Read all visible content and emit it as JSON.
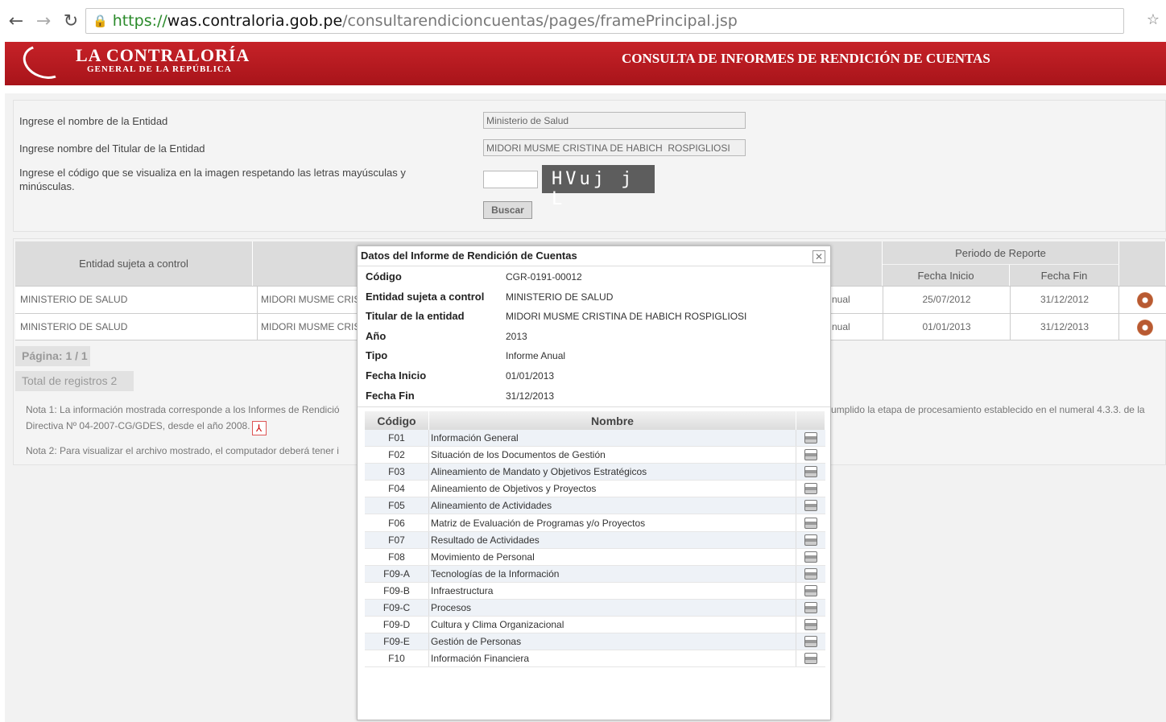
{
  "browser": {
    "url_scheme": "https://",
    "url_host": "was.contraloria.gob.pe",
    "url_path": "/consultarendicioncuentas/pages/framePrincipal.jsp"
  },
  "header": {
    "logo_title": "LA CONTRALORÍA",
    "logo_subtitle": "GENERAL DE LA REPÚBLICA",
    "page_title": "CONSULTA DE INFORMES DE RENDICIÓN DE CUENTAS"
  },
  "form": {
    "entidad_label": "Ingrese el nombre de la Entidad",
    "entidad_value": "Ministerio de Salud",
    "titular_label": "Ingrese nombre del Titular de la Entidad",
    "titular_value": "MIDORI MUSME CRISTINA DE HABICH  ROSPIGLIOSI",
    "captcha_label_1": "Ingrese el código que se visualiza en la imagen respetando las letras mayúsculas y",
    "captcha_label_2": "minúsculas.",
    "captcha_text": "HVuj j L",
    "buscar_label": "Buscar"
  },
  "results": {
    "col_entidad": "Entidad sujeta a control",
    "col_periodo": "Periodo de Reporte",
    "col_fecha_inicio": "Fecha Inicio",
    "col_fecha_fin": "Fecha Fin",
    "rows": [
      {
        "entidad": "MINISTERIO DE SALUD",
        "titular": "MIDORI MUSME CRIST",
        "tipo": "nual",
        "fecha_inicio": "25/07/2012",
        "fecha_fin": "31/12/2012"
      },
      {
        "entidad": "MINISTERIO DE SALUD",
        "titular": "MIDORI MUSME CRIST",
        "tipo": "nual",
        "fecha_inicio": "01/01/2013",
        "fecha_fin": "31/12/2013"
      }
    ],
    "pagina": "Página: 1 / 1",
    "total": "Total de registros 2",
    "nota1_left": "Nota 1: La información mostrada corresponde a los Informes de Rendició",
    "nota1_right": "umplido la etapa de procesamiento establecido en el numeral 4.3.3. de la",
    "nota1_line2": "Directiva Nº 04-2007-CG/GDES, desde el año 2008.",
    "nota2": "Nota 2: Para visualizar el archivo mostrado, el computador deberá tener i"
  },
  "modal": {
    "title": "Datos del Informe de Rendición de Cuentas",
    "codigo_label": "Código",
    "codigo_value": "CGR-0191-00012",
    "entidad_label": "Entidad sujeta a control",
    "entidad_value": "MINISTERIO DE SALUD",
    "titular_label": "Titular de la entidad",
    "titular_value": "MIDORI MUSME CRISTINA DE HABICH ROSPIGLIOSI",
    "anio_label": "Año",
    "anio_value": "2013",
    "tipo_label": "Tipo",
    "tipo_value": "Informe Anual",
    "fecha_inicio_label": "Fecha Inicio",
    "fecha_inicio_value": "01/01/2013",
    "fecha_fin_label": "Fecha Fin",
    "fecha_fin_value": "31/12/2013",
    "col_codigo": "Código",
    "col_nombre": "Nombre",
    "formatos": [
      {
        "codigo": "F01",
        "nombre": "Información General"
      },
      {
        "codigo": "F02",
        "nombre": "Situación de los Documentos de Gestión"
      },
      {
        "codigo": "F03",
        "nombre": "Alineamiento de Mandato y Objetivos Estratégicos"
      },
      {
        "codigo": "F04",
        "nombre": "Alineamiento de Objetivos y Proyectos"
      },
      {
        "codigo": "F05",
        "nombre": "Alineamiento de Actividades"
      },
      {
        "codigo": "F06",
        "nombre": "Matriz de Evaluación de Programas y/o Proyectos"
      },
      {
        "codigo": "F07",
        "nombre": "Resultado de Actividades"
      },
      {
        "codigo": "F08",
        "nombre": "Movimiento de Personal"
      },
      {
        "codigo": "F09-A",
        "nombre": "Tecnologías de la Información"
      },
      {
        "codigo": "F09-B",
        "nombre": "Infraestructura"
      },
      {
        "codigo": "F09-C",
        "nombre": "Procesos"
      },
      {
        "codigo": "F09-D",
        "nombre": "Cultura y Clima Organizacional"
      },
      {
        "codigo": "F09-E",
        "nombre": "Gestión de Personas"
      },
      {
        "codigo": "F10",
        "nombre": "Información Financiera"
      }
    ]
  }
}
